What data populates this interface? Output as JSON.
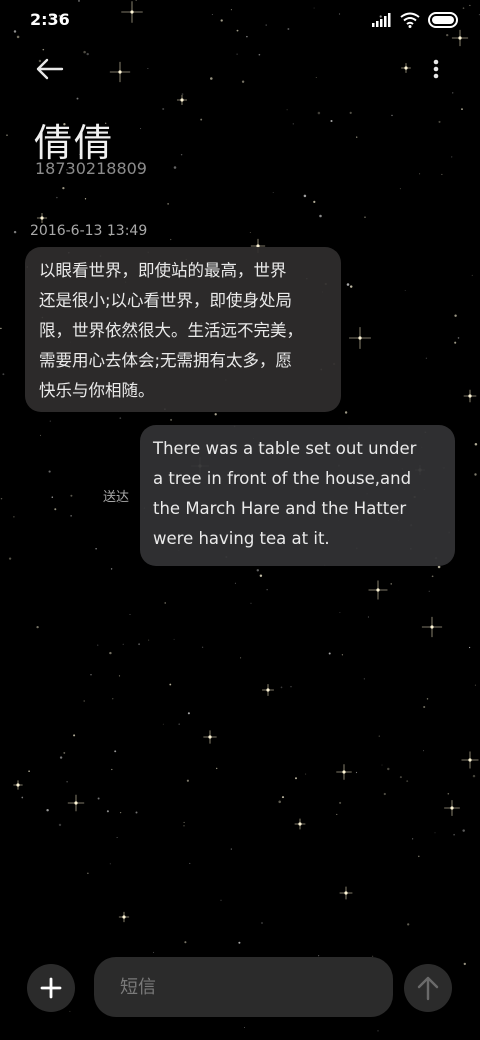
{
  "status_bar": {
    "time": "2:36",
    "signal_icon": "signal-bars-icon",
    "wifi_icon": "wifi-icon",
    "battery_icon": "battery-icon"
  },
  "header": {
    "back_icon": "back-arrow-icon",
    "more_icon": "more-vertical-icon",
    "contact_name": "倩倩",
    "contact_number": "18730218809"
  },
  "conversation": {
    "timestamp": "2016-6-13 13:49",
    "messages": [
      {
        "direction": "incoming",
        "lines": [
          "以眼看世界，即使站的最高，世界",
          "还是很小;以心看世界，即使身处局",
          "限，世界依然很大。生活远不完美，",
          "需要用心去体会;无需拥有太多，愿",
          "快乐与你相随。"
        ]
      },
      {
        "direction": "outgoing",
        "status": "送达",
        "lines": [
          "There was a table set out under",
          "a tree in front of the house,and",
          "the March Hare and the Hatter",
          "were having tea at it."
        ]
      }
    ]
  },
  "composer": {
    "add_icon": "plus-icon",
    "placeholder": "短信",
    "send_icon": "send-arrow-up-icon"
  },
  "colors": {
    "background": "#000000",
    "bubble": "#302e2e",
    "text": "#eaeaea",
    "muted": "#8c8c8c"
  }
}
